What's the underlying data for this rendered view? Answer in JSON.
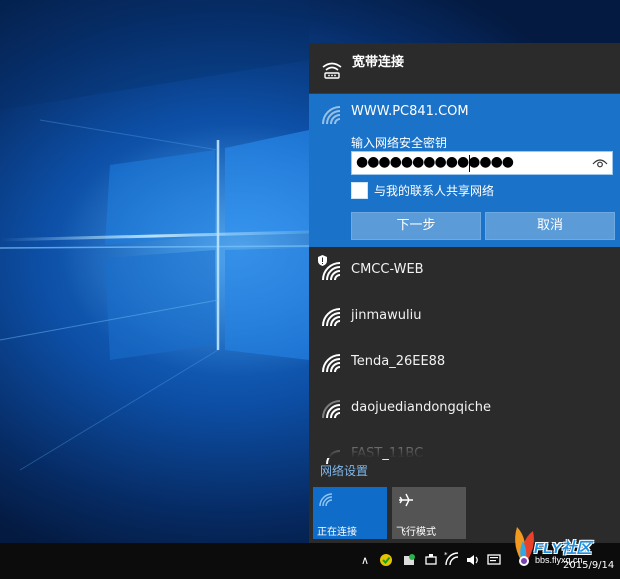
{
  "flyout": {
    "broadband": {
      "label": "宽带连接",
      "icon": "dialup-icon"
    },
    "active_network": {
      "ssid": "WWW.PC841.COM",
      "prompt": "输入网络安全密钥",
      "password_masked": "●●●●●●●●●●●●●●",
      "share_label": "与我的联系人共享网络",
      "share_checked": false,
      "next_label": "下一步",
      "cancel_label": "取消"
    },
    "networks": [
      {
        "name": "CMCC-WEB",
        "secured": false,
        "icon": "wifi-icon"
      },
      {
        "name": "jinmawuliu",
        "secured": true,
        "icon": "wifi-icon"
      },
      {
        "name": "Tenda_26EE88",
        "secured": true,
        "icon": "wifi-icon"
      },
      {
        "name": "daojuediandongqiche",
        "secured": true,
        "icon": "wifi-icon"
      },
      {
        "name": "FAST_11BC",
        "secured": true,
        "icon": "wifi-icon"
      }
    ],
    "settings_link": "网络设置",
    "quick_actions": [
      {
        "label": "正在连接",
        "icon": "wifi-icon",
        "active": true
      },
      {
        "label": "飞行模式",
        "icon": "airplane-icon",
        "active": false
      }
    ]
  },
  "taskbar": {
    "chevron": "∧",
    "date": "2015/9/14"
  },
  "watermark": {
    "brand": "FLY社区",
    "url": "bbs.flyxq.cn"
  },
  "colors": {
    "accent": "#1a73c8",
    "flyout_bg": "#2b2b2b",
    "link": "#7fb8ec"
  }
}
